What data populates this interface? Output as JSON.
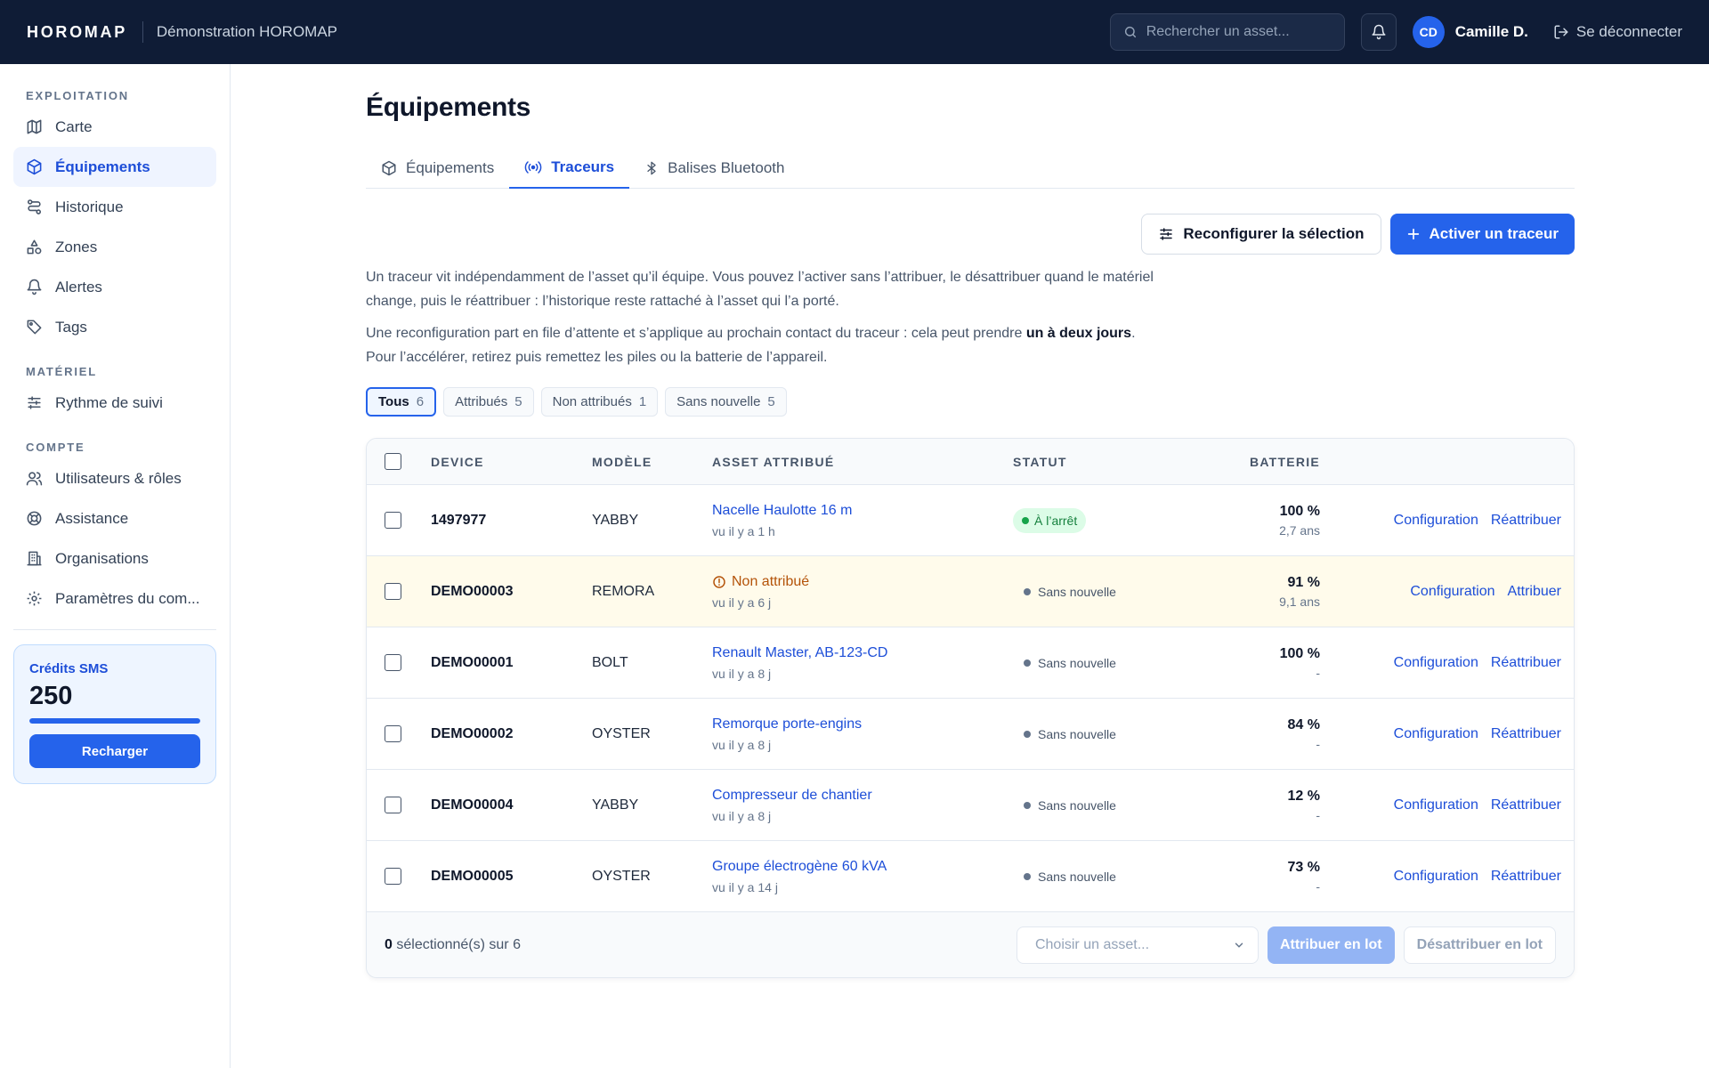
{
  "header": {
    "logo": "HOROMAP",
    "org": "Démonstration HOROMAP",
    "search_placeholder": "Rechercher un asset...",
    "avatar_initials": "CD",
    "user_name": "Camille D.",
    "logout": "Se déconnecter"
  },
  "sidebar": {
    "sections": [
      {
        "title": "EXPLOITATION",
        "items": [
          {
            "label": "Carte",
            "icon": "map-icon"
          },
          {
            "label": "Équipements",
            "icon": "box-icon",
            "active": true
          },
          {
            "label": "Historique",
            "icon": "route-icon"
          },
          {
            "label": "Zones",
            "icon": "shapes-icon"
          },
          {
            "label": "Alertes",
            "icon": "bell-icon"
          },
          {
            "label": "Tags",
            "icon": "tag-icon"
          }
        ]
      },
      {
        "title": "MATÉRIEL",
        "items": [
          {
            "label": "Rythme de suivi",
            "icon": "sliders-icon"
          }
        ]
      },
      {
        "title": "COMPTE",
        "items": [
          {
            "label": "Utilisateurs & rôles",
            "icon": "users-icon"
          },
          {
            "label": "Assistance",
            "icon": "lifebuoy-icon"
          },
          {
            "label": "Organisations",
            "icon": "building-icon"
          },
          {
            "label": "Paramètres du com...",
            "icon": "gear-icon"
          }
        ]
      }
    ],
    "sms": {
      "title": "Crédits SMS",
      "value": "250",
      "fill_fraction": 1.0,
      "button": "Recharger"
    }
  },
  "page": {
    "title": "Équipements",
    "tabs": [
      {
        "label": "Équipements",
        "icon": "box-icon"
      },
      {
        "label": "Traceurs",
        "icon": "broadcast-icon",
        "active": true
      },
      {
        "label": "Balises Bluetooth",
        "icon": "bluetooth-icon"
      }
    ],
    "reconfigure_button": "Reconfigurer la sélection",
    "activate_button": "Activer un traceur",
    "desc1": "Un traceur vit indépendamment de l’asset qu’il équipe. Vous pouvez l’activer sans l’attribuer, le désattribuer quand le matériel change, puis le réattribuer : l’historique reste rattaché à l’asset qui l’a porté.",
    "desc2_before": "Une reconfiguration part en file d’attente et s’applique au prochain contact du traceur : cela peut prendre ",
    "desc2_bold": "un à deux jours",
    "desc2_after": ".",
    "desc3": "Pour l’accélérer, retirez puis remettez les piles ou la batterie de l’appareil.",
    "filters": [
      {
        "label": "Tous",
        "count": "6",
        "active": true
      },
      {
        "label": "Attribués",
        "count": "5"
      },
      {
        "label": "Non attribués",
        "count": "1"
      },
      {
        "label": "Sans nouvelle",
        "count": "5"
      }
    ]
  },
  "table": {
    "columns": {
      "device": "DEVICE",
      "model": "MODÈLE",
      "asset": "ASSET ATTRIBUÉ",
      "status": "STATUT",
      "battery": "BATTERIE"
    },
    "rows": [
      {
        "device": "1497977",
        "model": "YABBY",
        "asset": "Nacelle Haulotte 16 m",
        "seen": "vu il y a 1 h",
        "status": "À l’arrêt",
        "status_kind": "ok",
        "battery": "100 %",
        "battery_sub": "2,7 ans",
        "action1": "Configuration",
        "action2": "Réattribuer"
      },
      {
        "device": "DEMO00003",
        "model": "REMORA",
        "asset": "Non attribué",
        "seen": "vu il y a 6 j",
        "status": "Sans nouvelle",
        "status_kind": "none",
        "battery": "91 %",
        "battery_sub": "9,1 ans",
        "action1": "Configuration",
        "action2": "Attribuer",
        "warn": true
      },
      {
        "device": "DEMO00001",
        "model": "BOLT",
        "asset": "Renault Master, AB-123-CD",
        "seen": "vu il y a 8 j",
        "status": "Sans nouvelle",
        "status_kind": "none",
        "battery": "100 %",
        "battery_sub": "-",
        "action1": "Configuration",
        "action2": "Réattribuer"
      },
      {
        "device": "DEMO00002",
        "model": "OYSTER",
        "asset": "Remorque porte-engins",
        "seen": "vu il y a 8 j",
        "status": "Sans nouvelle",
        "status_kind": "none",
        "battery": "84 %",
        "battery_sub": "-",
        "action1": "Configuration",
        "action2": "Réattribuer"
      },
      {
        "device": "DEMO00004",
        "model": "YABBY",
        "asset": "Compresseur de chantier",
        "seen": "vu il y a 8 j",
        "status": "Sans nouvelle",
        "status_kind": "none",
        "battery": "12 %",
        "battery_sub": "-",
        "action1": "Configuration",
        "action2": "Réattribuer"
      },
      {
        "device": "DEMO00005",
        "model": "OYSTER",
        "asset": "Groupe électrogène 60 kVA",
        "seen": "vu il y a 14 j",
        "status": "Sans nouvelle",
        "status_kind": "none",
        "battery": "73 %",
        "battery_sub": "-",
        "action1": "Configuration",
        "action2": "Réattribuer"
      }
    ],
    "footer": {
      "selected_count": "0",
      "selected_suffix": "sélectionné(s) sur 6",
      "asset_select_placeholder": "Choisir un asset...",
      "assign_bulk": "Attribuer en lot",
      "unassign_bulk": "Désattribuer en lot"
    }
  },
  "colors": {
    "topbar": "#0f1c36",
    "accent": "#2563eb",
    "link": "#1d4ed8",
    "warn": "#b45309",
    "ok": "#15803d"
  }
}
